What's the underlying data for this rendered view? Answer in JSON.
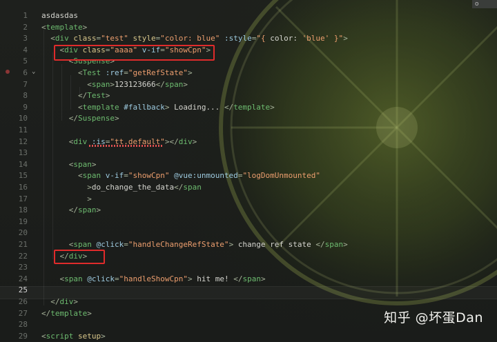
{
  "corner_label": "o",
  "watermark": "知乎 @坏蛋Dan",
  "lines": [
    {
      "n": "1",
      "segs": [
        [
          "text",
          "asdasdas"
        ]
      ]
    },
    {
      "n": "2",
      "segs": [
        [
          "punct",
          "<"
        ],
        [
          "tag",
          "template"
        ],
        [
          "punct",
          ">"
        ]
      ]
    },
    {
      "n": "3",
      "segs": [
        [
          "punct",
          "  <"
        ],
        [
          "tag",
          "div "
        ],
        [
          "attr",
          "class"
        ],
        [
          "punct",
          "="
        ],
        [
          "str",
          "\"test\""
        ],
        [
          "attr",
          " style"
        ],
        [
          "punct",
          "="
        ],
        [
          "str",
          "\"color: blue\""
        ],
        [
          "dir",
          " :style"
        ],
        [
          "punct",
          "="
        ],
        [
          "str",
          "\"{ "
        ],
        [
          "text",
          "color: "
        ],
        [
          "str",
          "'blue'"
        ],
        [
          "str",
          " }\""
        ],
        [
          "punct",
          ">"
        ]
      ]
    },
    {
      "n": "4",
      "segs": [
        [
          "punct",
          "    <"
        ],
        [
          "tag",
          "div "
        ],
        [
          "attr",
          "class"
        ],
        [
          "punct",
          "="
        ],
        [
          "str",
          "\"aaaa\""
        ],
        [
          "dir",
          " v-if"
        ],
        [
          "punct",
          "="
        ],
        [
          "str",
          "\"showCpn\""
        ],
        [
          "punct",
          ">"
        ]
      ]
    },
    {
      "n": "5",
      "segs": [
        [
          "punct",
          "      <"
        ],
        [
          "tag",
          "Suspense"
        ],
        [
          "punct",
          ">"
        ]
      ]
    },
    {
      "n": "6",
      "segs": [
        [
          "punct",
          "        <"
        ],
        [
          "tag",
          "Test "
        ],
        [
          "dir",
          ":ref"
        ],
        [
          "punct",
          "="
        ],
        [
          "str",
          "\"getRefState\""
        ],
        [
          "punct",
          ">"
        ]
      ]
    },
    {
      "n": "7",
      "segs": [
        [
          "punct",
          "          <"
        ],
        [
          "tag",
          "span"
        ],
        [
          "punct",
          ">"
        ],
        [
          "text",
          "123123666"
        ],
        [
          "punct",
          "</"
        ],
        [
          "tag",
          "span"
        ],
        [
          "punct",
          ">"
        ]
      ]
    },
    {
      "n": "8",
      "segs": [
        [
          "punct",
          "        </"
        ],
        [
          "tag",
          "Test"
        ],
        [
          "punct",
          ">"
        ]
      ]
    },
    {
      "n": "9",
      "segs": [
        [
          "punct",
          "        <"
        ],
        [
          "tag",
          "template "
        ],
        [
          "dir",
          "#fallback"
        ],
        [
          "punct",
          "> "
        ],
        [
          "text",
          "Loading... "
        ],
        [
          "punct",
          "</"
        ],
        [
          "tag",
          "template"
        ],
        [
          "punct",
          ">"
        ]
      ]
    },
    {
      "n": "10",
      "segs": [
        [
          "punct",
          "      </"
        ],
        [
          "tag",
          "Suspense"
        ],
        [
          "punct",
          ">"
        ]
      ]
    },
    {
      "n": "11",
      "segs": []
    },
    {
      "n": "12",
      "segs": [
        [
          "punct",
          "      <"
        ],
        [
          "tag",
          "div "
        ],
        [
          "dir",
          ":is"
        ],
        [
          "punct",
          "="
        ],
        [
          "str",
          "\"tt.default\""
        ],
        [
          "punct",
          "></"
        ],
        [
          "tag",
          "div"
        ],
        [
          "punct",
          ">"
        ]
      ]
    },
    {
      "n": "13",
      "segs": []
    },
    {
      "n": "14",
      "segs": [
        [
          "punct",
          "      <"
        ],
        [
          "tag",
          "span"
        ],
        [
          "punct",
          ">"
        ]
      ]
    },
    {
      "n": "15",
      "segs": [
        [
          "punct",
          "        <"
        ],
        [
          "tag",
          "span "
        ],
        [
          "dir",
          "v-if"
        ],
        [
          "punct",
          "="
        ],
        [
          "str",
          "\"showCpn\""
        ],
        [
          "dir",
          " @vue:unmounted"
        ],
        [
          "punct",
          "="
        ],
        [
          "str",
          "\"logDomUnmounted\""
        ]
      ]
    },
    {
      "n": "16",
      "segs": [
        [
          "punct",
          "          >"
        ],
        [
          "text",
          "do_change_the_data"
        ],
        [
          "punct",
          "</"
        ],
        [
          "tag",
          "span"
        ]
      ]
    },
    {
      "n": "17",
      "segs": [
        [
          "punct",
          "          >"
        ]
      ]
    },
    {
      "n": "18",
      "segs": [
        [
          "punct",
          "      </"
        ],
        [
          "tag",
          "span"
        ],
        [
          "punct",
          ">"
        ]
      ]
    },
    {
      "n": "19",
      "segs": []
    },
    {
      "n": "20",
      "segs": []
    },
    {
      "n": "21",
      "segs": [
        [
          "punct",
          "      <"
        ],
        [
          "tag",
          "span "
        ],
        [
          "dir",
          "@click"
        ],
        [
          "punct",
          "="
        ],
        [
          "str",
          "\"handleChangeRefState\""
        ],
        [
          "punct",
          "> "
        ],
        [
          "text",
          "change ref state "
        ],
        [
          "punct",
          "</"
        ],
        [
          "tag",
          "span"
        ],
        [
          "punct",
          ">"
        ]
      ]
    },
    {
      "n": "22",
      "segs": [
        [
          "punct",
          "    </"
        ],
        [
          "tag",
          "div"
        ],
        [
          "punct",
          ">"
        ]
      ]
    },
    {
      "n": "23",
      "segs": []
    },
    {
      "n": "24",
      "segs": [
        [
          "punct",
          "    <"
        ],
        [
          "tag",
          "span "
        ],
        [
          "dir",
          "@click"
        ],
        [
          "punct",
          "="
        ],
        [
          "str",
          "\"handleShowCpn\""
        ],
        [
          "punct",
          "> "
        ],
        [
          "text",
          "hit me! "
        ],
        [
          "punct",
          "</"
        ],
        [
          "tag",
          "span"
        ],
        [
          "punct",
          ">"
        ]
      ]
    },
    {
      "n": "25",
      "segs": []
    },
    {
      "n": "26",
      "segs": [
        [
          "punct",
          "  </"
        ],
        [
          "tag",
          "div"
        ],
        [
          "punct",
          ">"
        ]
      ]
    },
    {
      "n": "27",
      "segs": [
        [
          "punct",
          "</"
        ],
        [
          "tag",
          "template"
        ],
        [
          "punct",
          ">"
        ]
      ]
    },
    {
      "n": "28",
      "segs": []
    },
    {
      "n": "29",
      "segs": [
        [
          "punct",
          "<"
        ],
        [
          "tag",
          "script "
        ],
        [
          "attr",
          "setup"
        ],
        [
          "punct",
          ">"
        ]
      ]
    }
  ]
}
